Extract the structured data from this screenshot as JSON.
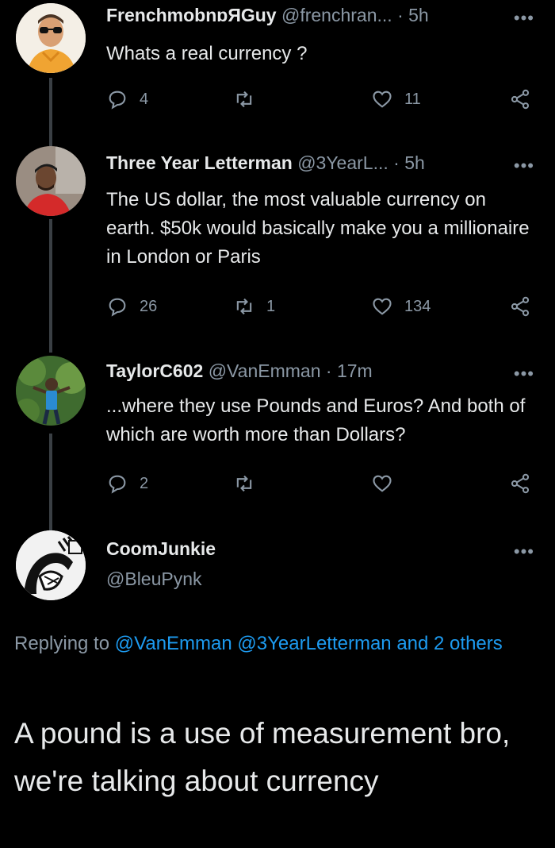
{
  "tweets": [
    {
      "display_name": "FrenchmobnɒЯGuy",
      "handle": "@frenchran...",
      "time": "· 5h",
      "text": "Whats a real currency ?",
      "replies": "4",
      "retweets": "",
      "likes": "11"
    },
    {
      "display_name": "Three Year Letterman",
      "handle": "@3YearL...",
      "time": "· 5h",
      "text": "The US dollar, the most valuable currency on earth. $50k would basically make you a millionaire in London or Paris",
      "replies": "26",
      "retweets": "1",
      "likes": "134"
    },
    {
      "display_name": "TaylorC602",
      "handle": "@VanEmman",
      "time": "· 17m",
      "text": "...where they use Pounds and Euros? And both of which are worth more than Dollars?",
      "replies": "2",
      "retweets": "",
      "likes": ""
    }
  ],
  "main_tweet": {
    "display_name": "CoomJunkie",
    "handle": "@BleuPynk",
    "replying_prefix": "Replying to ",
    "replying_to": "@VanEmman @3YearLetterman and 2 others",
    "text": "A pound is a use of measurement bro, we're talking about currency"
  },
  "more_label": "•••",
  "colors": {
    "background": "#000000",
    "text": "#e7e9ea",
    "muted": "#8b98a5",
    "link": "#1d9bf0",
    "thread_line": "#3a3f44"
  }
}
